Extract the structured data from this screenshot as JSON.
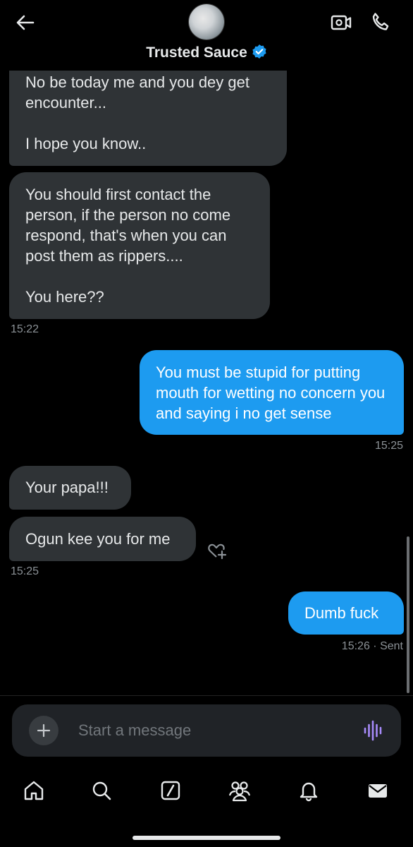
{
  "header": {
    "contact_name": "Trusted Sauce",
    "verified": true,
    "icons": [
      "back-arrow-icon",
      "video-call-icon",
      "phone-icon",
      "verified-badge-icon"
    ]
  },
  "messages": [
    {
      "direction": "in",
      "text": "No be today me and you dey get encounter...\n\nI hope you know.."
    },
    {
      "direction": "in",
      "text": "You should first contact the person, if the person no come respond, that's when you can post them as rippers....\n\nYou here??",
      "time": "15:22"
    },
    {
      "direction": "out",
      "text": "You must be stupid for putting mouth for wetting no concern you and saying i no get sense",
      "time": "15:25"
    },
    {
      "direction": "in",
      "text": "Your papa!!!"
    },
    {
      "direction": "in",
      "text": "Ogun kee you for me",
      "time": "15:25"
    },
    {
      "direction": "out",
      "text": "Dumb fuck",
      "time": "15:26",
      "status": "Sent"
    }
  ],
  "composer": {
    "placeholder": "Start a message",
    "icons": [
      "plus-icon",
      "voice-wave-icon"
    ]
  },
  "bottom_nav": {
    "items": [
      "home-icon",
      "search-icon",
      "grok-icon",
      "communities-icon",
      "notifications-icon",
      "messages-icon"
    ],
    "active": "messages-icon"
  },
  "colors": {
    "background": "#000000",
    "incoming_bubble": "#2f3336",
    "outgoing_bubble": "#1d9bf0",
    "verified": "#1d9bf0",
    "voice_accent": "#a78bfa"
  }
}
